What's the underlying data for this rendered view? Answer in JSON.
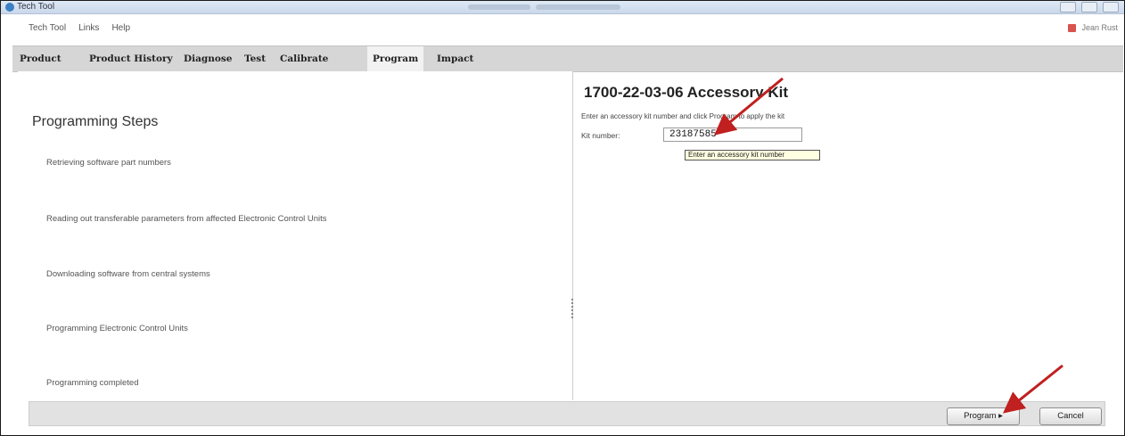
{
  "window": {
    "title": "Tech Tool"
  },
  "menu": {
    "items": [
      "Tech Tool",
      "Links",
      "Help"
    ]
  },
  "user": {
    "name": "Jean Rust"
  },
  "tabs": [
    {
      "label": "Product"
    },
    {
      "label": "Product History"
    },
    {
      "label": "Diagnose"
    },
    {
      "label": "Test"
    },
    {
      "label": "Calibrate"
    },
    {
      "label": "Program",
      "active": true
    },
    {
      "label": "Impact"
    }
  ],
  "programming": {
    "title": "Programming Steps",
    "steps": [
      "Retrieving software part numbers",
      "Reading out transferable parameters from affected Electronic Control Units",
      "Downloading software from central systems",
      "Programming Electronic Control Units",
      "Programming completed"
    ]
  },
  "kit": {
    "title": "1700-22-03-06 Accessory Kit",
    "description": "Enter an accessory kit number and click Program to apply the kit",
    "label": "Kit number:",
    "value": "23187585",
    "tooltip": "Enter an accessory kit number"
  },
  "buttons": {
    "program": "Program ▸",
    "cancel": "Cancel"
  },
  "colors": {
    "annotation_arrow": "#c0201f",
    "tab_bar": "#d6d6d6",
    "tooltip_bg": "#ffffe1"
  },
  "icons": {
    "app": "tech-tool-icon",
    "user": "user-icon"
  }
}
